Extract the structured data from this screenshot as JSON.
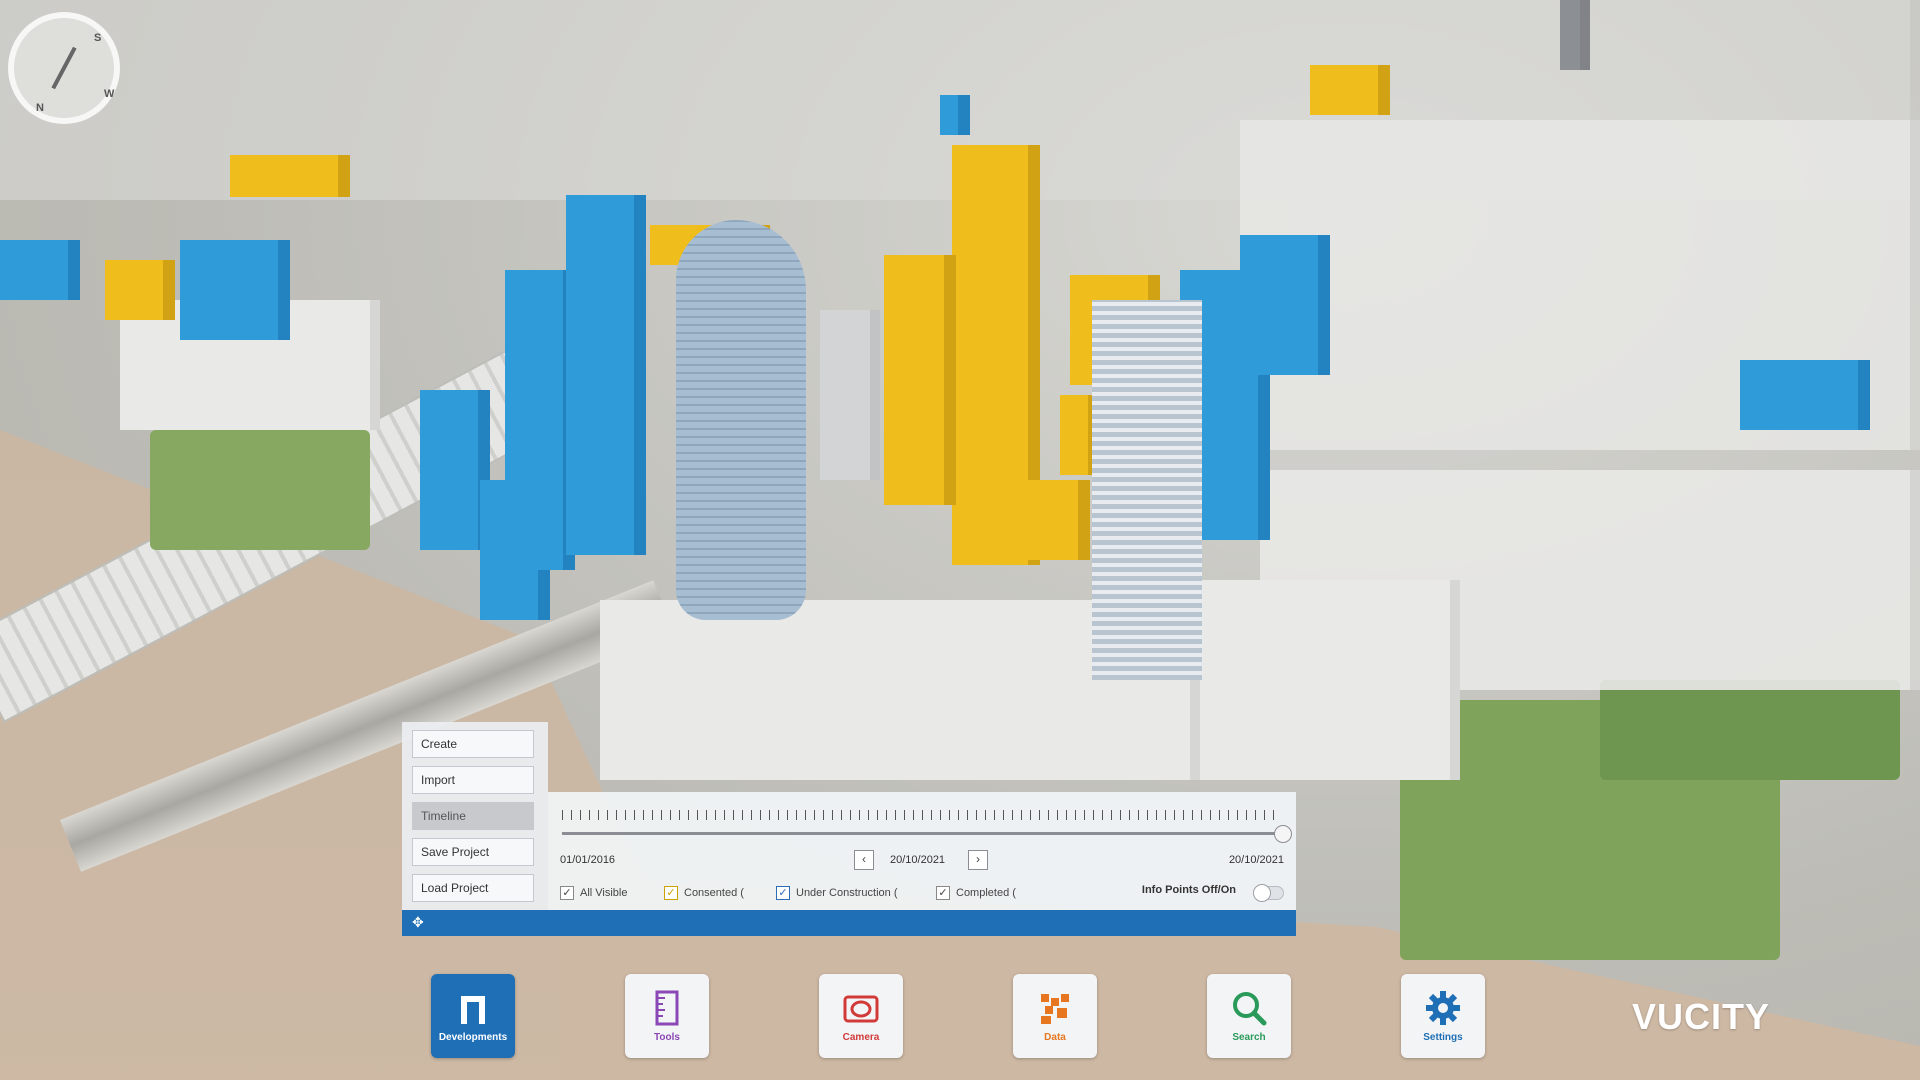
{
  "compass": {
    "n": "N",
    "s": "S",
    "w": "W"
  },
  "menu": {
    "items": [
      {
        "label": "Create"
      },
      {
        "label": "Import"
      },
      {
        "label": "Timeline",
        "active": true
      },
      {
        "label": "Save Project"
      },
      {
        "label": "Load Project"
      }
    ]
  },
  "timeline": {
    "start_date": "01/01/2016",
    "current_date": "20/10/2021",
    "end_date": "20/10/2021",
    "slider_position": 1.0,
    "prev_icon": "chevron-left-icon",
    "next_icon": "chevron-right-icon",
    "filters": [
      {
        "label": "All Visible",
        "checked": true
      },
      {
        "label": "Consented (",
        "checked": true,
        "color": "#c9a400"
      },
      {
        "label": "Under Construction (",
        "checked": true,
        "color": "#2d6db5"
      },
      {
        "label": "Completed (",
        "checked": true
      }
    ],
    "toggle_label": "Info Points Off/On",
    "toggle_on": false
  },
  "dock": [
    {
      "label": "Developments",
      "icon": "developments-icon",
      "active": true,
      "color": "#ffffff"
    },
    {
      "label": "Tools",
      "icon": "tools-icon",
      "active": false,
      "color": "#8a47b5"
    },
    {
      "label": "Camera",
      "icon": "camera-icon",
      "active": false,
      "color": "#d23a3a"
    },
    {
      "label": "Data",
      "icon": "data-icon",
      "active": false,
      "color": "#e6761f"
    },
    {
      "label": "Search",
      "icon": "search-icon",
      "active": false,
      "color": "#2a9a5a"
    },
    {
      "label": "Settings",
      "icon": "settings-icon",
      "active": false,
      "color": "#1f6fb6"
    }
  ],
  "brand": {
    "logo": "VUCITY"
  },
  "colors": {
    "accent": "#1f6fb6",
    "consented": "#f0be1c",
    "under_construction": "#2f9bd8"
  }
}
